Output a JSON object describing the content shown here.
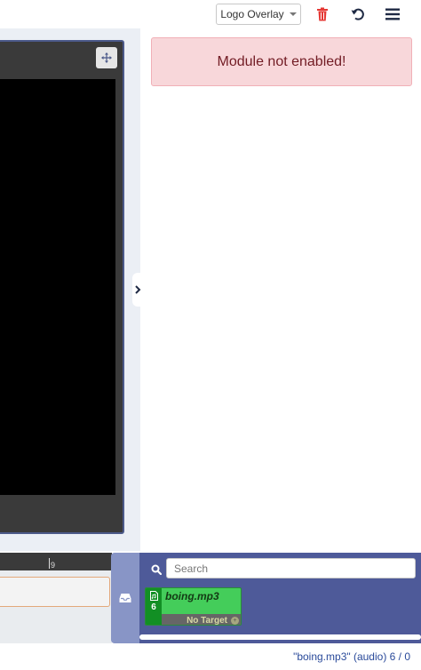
{
  "toolbar": {
    "dropdown_label": "Logo Overlay",
    "icons": [
      "trash-icon",
      "undo-icon",
      "hamburger-menu-icon"
    ]
  },
  "alert": {
    "message": "Module not enabled!"
  },
  "timeline": {
    "ruler_mark": "9"
  },
  "media_dock": {
    "search_placeholder": "Search",
    "items": [
      {
        "name": "boing.mp3",
        "count": "6",
        "target": "No Target",
        "color": "#44cd5a"
      }
    ]
  },
  "status_bar": {
    "text": "\"boing.mp3\" (audio) 6 / 0"
  },
  "colors": {
    "alert_bg": "#f8d7da",
    "alert_text": "#721c24",
    "dock_bg": "#4e5a99",
    "media_item": "#44cd5a",
    "delete_red": "#e53935"
  }
}
